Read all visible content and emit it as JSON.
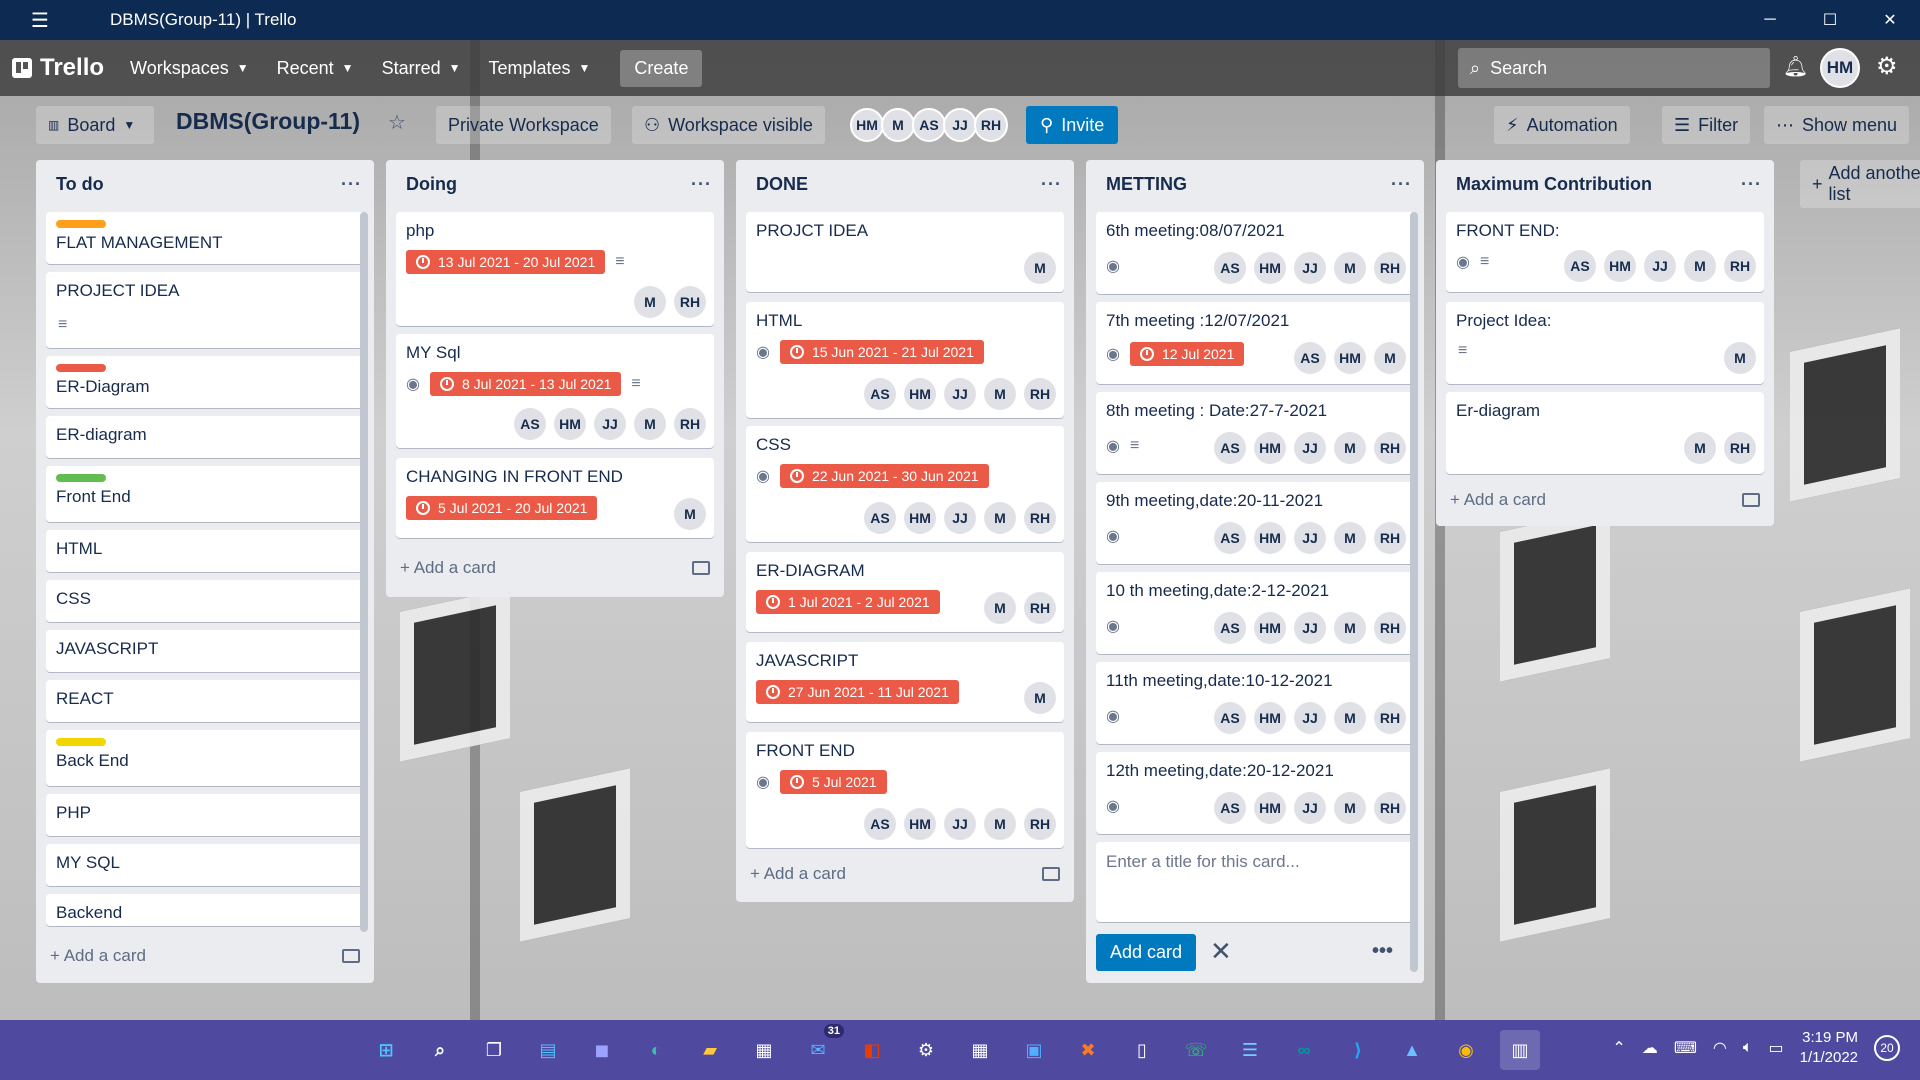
{
  "window": {
    "title": "DBMS(Group-11) | Trello",
    "min": "─",
    "max": "☐",
    "close": "✕"
  },
  "header": {
    "logo": "Trello",
    "nav": [
      {
        "label": "Workspaces"
      },
      {
        "label": "Recent"
      },
      {
        "label": "Starred"
      },
      {
        "label": "Templates"
      }
    ],
    "create": "Create",
    "search_placeholder": "Search",
    "user_initials": "HM"
  },
  "boardbar": {
    "board_view": "Board",
    "title": "DBMS(Group-11)",
    "workspace": "Private Workspace",
    "visibility": "Workspace visible",
    "members": [
      "HM",
      "M",
      "AS",
      "JJ",
      "RH"
    ],
    "invite": "Invite",
    "automation": "Automation",
    "filter": "Filter",
    "show_menu": "Show menu"
  },
  "lists": [
    {
      "title": "To do",
      "cards": [
        {
          "title": "FLAT MANAGEMENT",
          "label_color": "#ff9f1a"
        },
        {
          "title": "PROJECT IDEA",
          "has_desc": true
        },
        {
          "title": "ER-Diagram",
          "label_color": "#eb5a46"
        },
        {
          "title": "ER-diagram"
        },
        {
          "title": "Front End",
          "label_color": "#61bd4f"
        },
        {
          "title": "HTML"
        },
        {
          "title": "CSS"
        },
        {
          "title": "JAVASCRIPT"
        },
        {
          "title": "REACT"
        },
        {
          "title": "Back End",
          "label_color": "#f2d600"
        },
        {
          "title": "PHP"
        },
        {
          "title": "MY SQL"
        },
        {
          "title": "Backend"
        }
      ],
      "add_card": "Add a card"
    },
    {
      "title": "Doing",
      "cards": [
        {
          "title": "php",
          "due": "13 Jul 2021 - 20 Jul 2021",
          "members": [
            "M",
            "RH"
          ]
        },
        {
          "title": "MY Sql",
          "due": "8 Jul 2021 - 13 Jul 2021",
          "members": [
            "AS",
            "HM",
            "JJ",
            "M",
            "RH"
          ]
        },
        {
          "title": "CHANGING IN FRONT END",
          "due": "5 Jul 2021 - 20 Jul 2021",
          "members": [
            "M"
          ]
        }
      ],
      "add_card": "Add a card"
    },
    {
      "title": "DONE",
      "cards": [
        {
          "title": "PROJCT IDEA",
          "members": [
            "M"
          ]
        },
        {
          "title": "HTML",
          "due": "15 Jun 2021 - 21 Jul 2021",
          "members": [
            "AS",
            "HM",
            "JJ",
            "M",
            "RH"
          ]
        },
        {
          "title": "CSS",
          "due": "22 Jun 2021 - 30 Jun 2021",
          "members": [
            "AS",
            "HM",
            "JJ",
            "M",
            "RH"
          ]
        },
        {
          "title": "ER-DIAGRAM",
          "due": "1 Jul 2021 - 2 Jul 2021",
          "members": [
            "M",
            "RH"
          ]
        },
        {
          "title": "JAVASCRIPT",
          "due": "27 Jun 2021 - 11 Jul 2021",
          "members": [
            "M"
          ]
        },
        {
          "title": "FRONT END",
          "due": "5 Jul 2021",
          "members": [
            "AS",
            "HM",
            "JJ",
            "M",
            "RH"
          ]
        }
      ],
      "add_card": "Add a card"
    },
    {
      "title": "METTING",
      "cards": [
        {
          "title": "6th meeting:08/07/2021",
          "members": [
            "AS",
            "HM",
            "JJ",
            "M",
            "RH"
          ]
        },
        {
          "title": "7th meeting :12/07/2021",
          "due": "12 Jul 2021",
          "members": [
            "AS",
            "HM",
            "M"
          ]
        },
        {
          "title": "8th meeting : Date:27-7-2021",
          "members": [
            "AS",
            "HM",
            "JJ",
            "M",
            "RH"
          ]
        },
        {
          "title": "9th meeting,date:20-11-2021",
          "members": [
            "AS",
            "HM",
            "JJ",
            "M",
            "RH"
          ]
        },
        {
          "title": "10 th meeting,date:2-12-2021",
          "members": [
            "AS",
            "HM",
            "JJ",
            "M",
            "RH"
          ]
        },
        {
          "title": "11th meeting,date:10-12-2021",
          "members": [
            "AS",
            "HM",
            "JJ",
            "M",
            "RH"
          ]
        },
        {
          "title": "12th meeting,date:20-12-2021",
          "members": [
            "AS",
            "HM",
            "JJ",
            "M",
            "RH"
          ]
        }
      ],
      "composer_placeholder": "Enter a title for this card...",
      "add_card_button": "Add card"
    },
    {
      "title": "Maximum Contribution",
      "cards": [
        {
          "title": "FRONT END:",
          "members": [
            "AS",
            "HM",
            "JJ",
            "M",
            "RH"
          ]
        },
        {
          "title": "Project Idea:",
          "members": [
            "M"
          ]
        },
        {
          "title": "Er-diagram",
          "members": [
            "M",
            "RH"
          ]
        }
      ],
      "add_card": "Add a card"
    }
  ],
  "add_list": "Add another list",
  "taskbar": {
    "mail_badge": "31",
    "time": "3:19 PM",
    "date": "1/1/2022",
    "notifications": "20"
  }
}
